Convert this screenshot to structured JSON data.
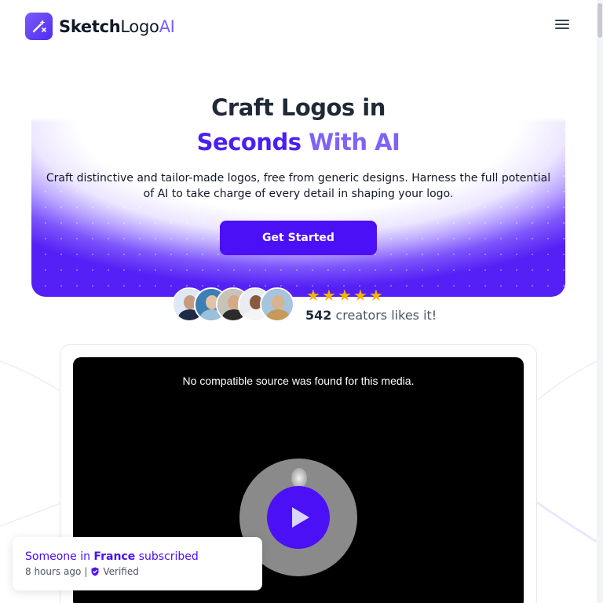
{
  "brand": {
    "name_bold": "Sketch",
    "name_regular": "Logo",
    "name_ai": "AI",
    "accent": "#4b10f5"
  },
  "header": {
    "menu_icon": "hamburger-menu-icon"
  },
  "hero": {
    "title_line1": "Craft Logos in",
    "title_line2_a": "Seconds ",
    "title_line2_b": "With AI",
    "subtitle": "Craft distinctive and tailor-made logos, free from generic designs. Harness the full potential of AI to take charge of every detail in shaping your logo.",
    "cta_label": "Get Started"
  },
  "social_proof": {
    "rating_stars": 5,
    "count": "542",
    "text": " creators likes it!",
    "avatars": [
      {
        "bg": "#dfe9f5",
        "skin": "#c99a7e",
        "shirt": "#1f2a44"
      },
      {
        "bg": "#3d7fb5",
        "skin": "#e2c3a8",
        "shirt": "#9cc0dc"
      },
      {
        "bg": "#c9c2b8",
        "skin": "#d6a987",
        "shirt": "#2b2b2b"
      },
      {
        "bg": "#e9edf2",
        "skin": "#8a5a3c",
        "shirt": "#f5f5f5"
      },
      {
        "bg": "#a7c4de",
        "skin": "#d9b28e",
        "shirt": "#c89a5a"
      }
    ]
  },
  "video": {
    "message": "No compatible source was found for this media.",
    "play_icon": "play-icon"
  },
  "toast": {
    "prefix": "Someone in ",
    "country": "France",
    "suffix": " subscribed",
    "time": "8 hours ago",
    "separator": "|",
    "verified": "Verified"
  }
}
